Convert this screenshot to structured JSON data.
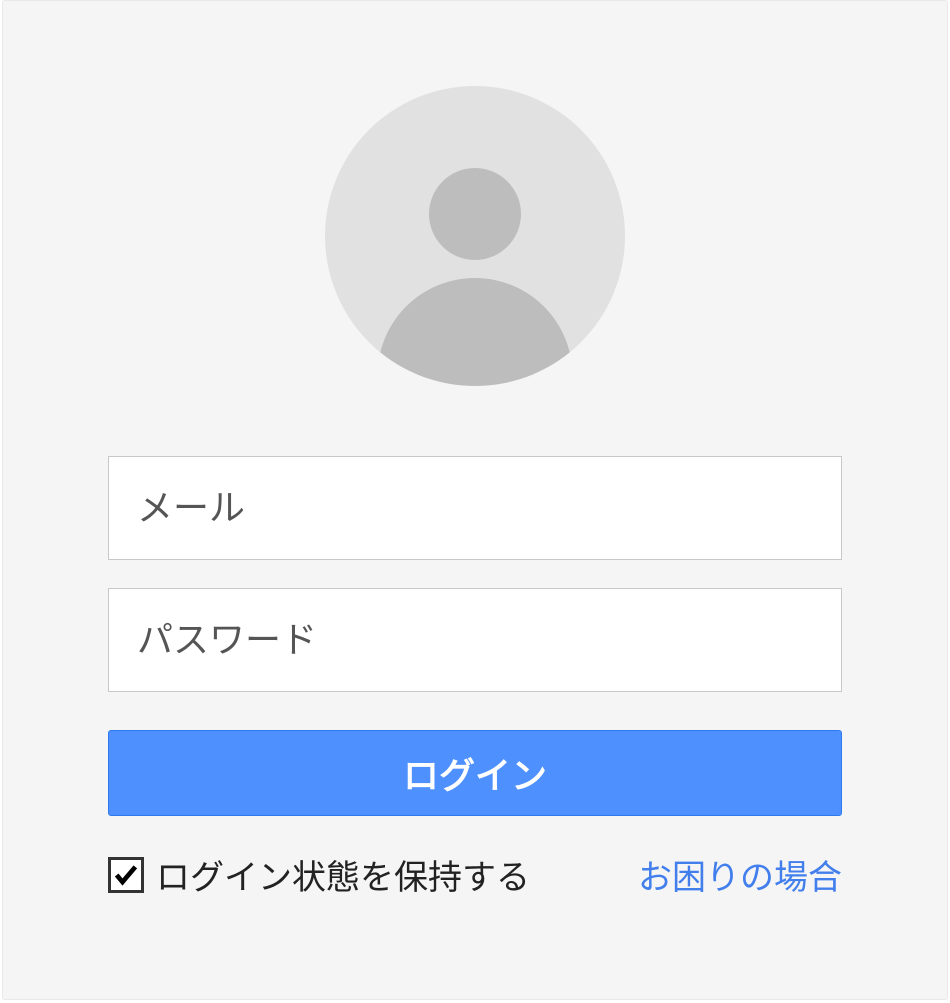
{
  "inputs": {
    "email_placeholder": "メール",
    "password_placeholder": "パスワード"
  },
  "buttons": {
    "login_label": "ログイン"
  },
  "remember": {
    "label": "ログイン状態を保持する",
    "checked": true
  },
  "help": {
    "label": "お困りの場合"
  }
}
